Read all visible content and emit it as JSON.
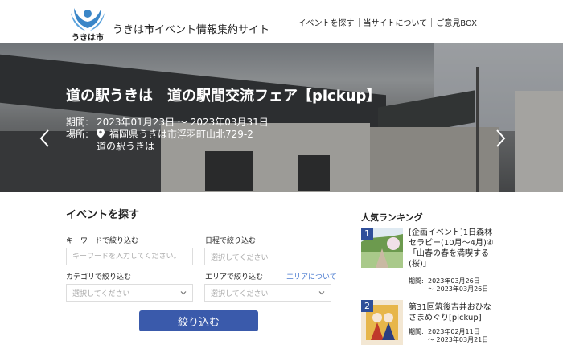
{
  "header": {
    "logo_text": "うきは市",
    "site_title": "うきは市イベント情報集約サイト",
    "nav": [
      "イベントを探す",
      "当サイトについて",
      "ご意見BOX"
    ]
  },
  "hero": {
    "title": "道の駅うきは　道の駅間交流フェア【pickup】",
    "period_label": "期間:",
    "period_value": "2023年01月23日 ～ 2023年03月31日",
    "place_label": "場所:",
    "place_address": "福岡県うきは市浮羽町山北729-2",
    "place_venue": "道の駅うきは",
    "icons": {
      "prev": "chevron-left-icon",
      "next": "chevron-right-icon",
      "location": "map-pin-icon"
    }
  },
  "search": {
    "title": "イベントを探す",
    "keyword_label": "キーワードで絞り込む",
    "keyword_placeholder": "キーワードを入力してください。",
    "date_label": "日程で絞り込む",
    "date_placeholder": "選択してください",
    "category_label": "カテゴリで絞り込む",
    "category_placeholder": "選択してください",
    "area_label": "エリアで絞り込む",
    "area_placeholder": "選択してください",
    "area_link": "エリアについて",
    "submit_label": "絞り込む"
  },
  "ranking": {
    "title": "人気ランキング",
    "items": [
      {
        "rank": "1",
        "name": "[企画イベント]1日森林セラピー(10月～4月)④「山春の春を満喫する(桜)」",
        "period_label": "期間:",
        "start": "2023年03月26日",
        "end": "～ 2023年03月26日"
      },
      {
        "rank": "2",
        "name": "第31回筑後吉井おひなさまめぐり[pickup]",
        "period_label": "期間:",
        "start": "2023年02月11日",
        "end": "～ 2023年03月21日"
      }
    ]
  },
  "colors": {
    "accent": "#3a5aab",
    "rank_badge": "#2f4f9a",
    "link": "#4a7bd0"
  }
}
